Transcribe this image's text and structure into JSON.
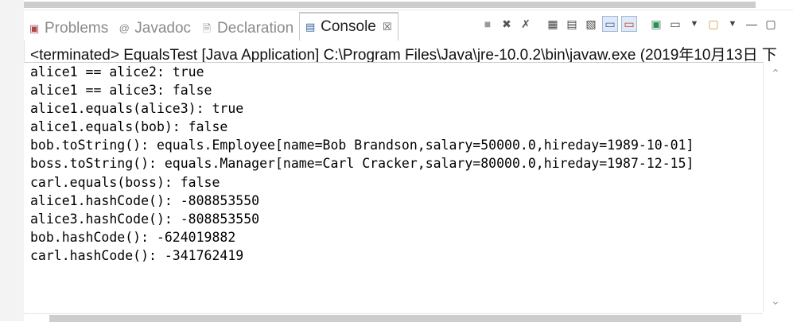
{
  "tabs": [
    {
      "label": "Problems",
      "icon": "problems-icon"
    },
    {
      "label": "Javadoc",
      "icon": "javadoc-icon"
    },
    {
      "label": "Declaration",
      "icon": "declaration-icon"
    },
    {
      "label": "Console",
      "icon": "console-icon",
      "active": true,
      "close": "☒"
    }
  ],
  "status": "<terminated> EqualsTest [Java Application] C:\\Program Files\\Java\\jre-10.0.2\\bin\\javaw.exe (2019年10月13日 下",
  "console": {
    "lines": [
      "alice1 == alice2: true",
      "alice1 == alice3: false",
      "alice1.equals(alice3): true",
      "alice1.equals(bob): false",
      "bob.toString(): equals.Employee[name=Bob Brandson,salary=50000.0,hireday=1989-10-01]",
      "boss.toString(): equals.Manager[name=Carl Cracker,salary=80000.0,hireday=1987-12-15]",
      "carl.equals(boss): false",
      "alice1.hashCode(): -808853550",
      "alice3.hashCode(): -808853550",
      "bob.hashCode(): -624019882",
      "carl.hashCode(): -341762419"
    ]
  },
  "toolbar_icons": [
    "terminate-icon",
    "remove-launch-icon",
    "remove-all-terminated-icon",
    "scroll-lock-icon",
    "word-wrap-icon",
    "show-on-stdout-icon",
    "show-on-stderr-icon",
    "pin-console-icon",
    "display-selected-console-icon",
    "open-console-icon",
    "dropdown-icon",
    "new-console-icon",
    "dropdown2-icon",
    "minimize-icon",
    "maximize-icon"
  ],
  "colors": {
    "accent": "#3c78c3",
    "error": "#c0392b"
  }
}
